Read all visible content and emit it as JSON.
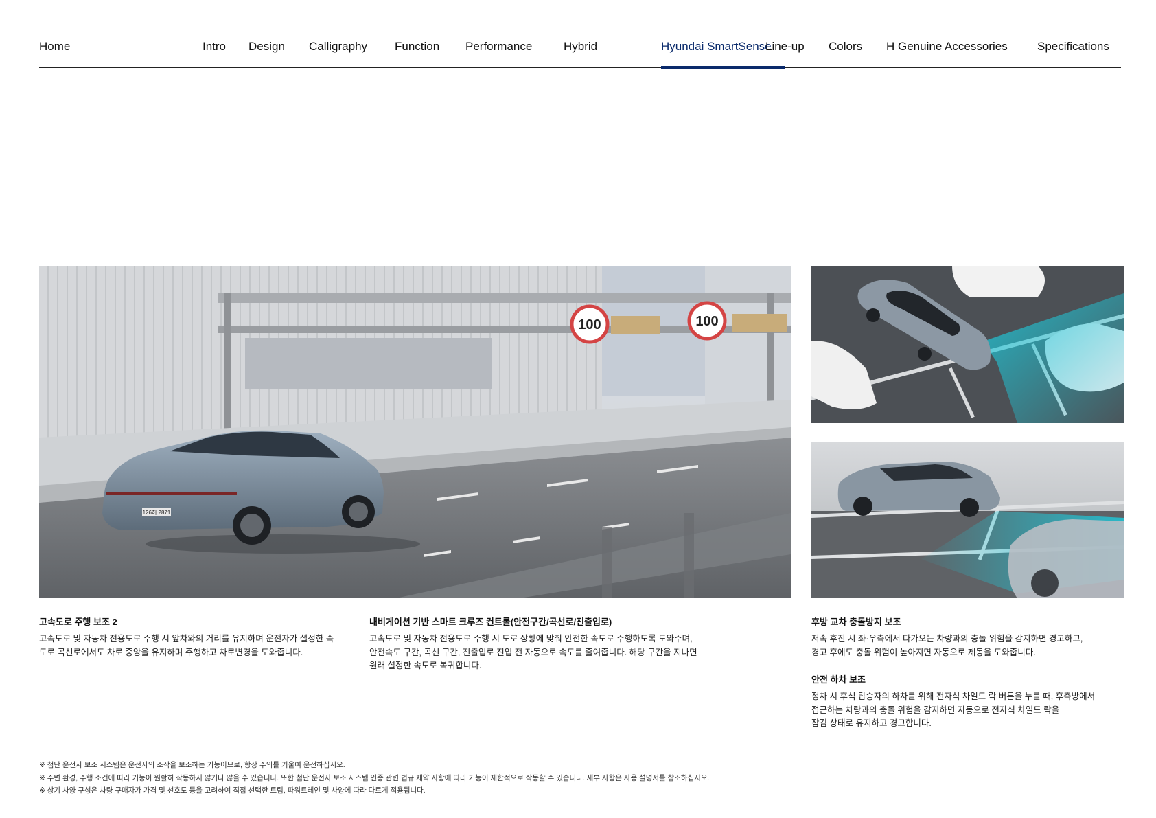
{
  "nav": {
    "items": [
      {
        "label": "Home",
        "active": false
      },
      {
        "label": "Intro",
        "active": false
      },
      {
        "label": "Design",
        "active": false
      },
      {
        "label": "Calligraphy",
        "active": false
      },
      {
        "label": "Function",
        "active": false
      },
      {
        "label": "Performance",
        "active": false
      },
      {
        "label": "Hybrid",
        "active": false
      },
      {
        "label": "Hyundai SmartSense",
        "active": true
      },
      {
        "label": "Line-up",
        "active": false
      },
      {
        "label": "Colors",
        "active": false
      },
      {
        "label": "H Genuine Accessories",
        "active": false
      },
      {
        "label": "Specifications",
        "active": false
      }
    ],
    "active_color": "#0a2a6b"
  },
  "images": {
    "highway": {
      "sign_text": "100",
      "plate_text": "126허 2871"
    }
  },
  "features": [
    {
      "title": "고속도로 주행 보조 2",
      "body": "고속도로 및 자동차 전용도로 주행 시 앞차와의 거리를 유지하며 운전자가 설정한 속\n도로 곡선로에서도 차로 중앙을 유지하며 주행하고 차로변경을 도와줍니다."
    },
    {
      "title": "내비게이션 기반 스마트 크루즈 컨트롤(안전구간/곡선로/진출입로)",
      "body": "고속도로 및 자동차 전용도로 주행 시 도로 상황에 맞춰 안전한 속도로 주행하도록 도와주며,\n안전속도 구간, 곡선 구간, 진출입로 진입 전 자동으로 속도를 줄여줍니다. 해당 구간을 지나면\n원래 설정한 속도로 복귀합니다."
    },
    {
      "title": "후방 교차 충돌방지 보조",
      "body": "저속 후진 시 좌·우측에서 다가오는 차량과의 충돌 위험을 감지하면 경고하고,\n경고 후에도 충돌 위험이 높아지면 자동으로 제동을 도와줍니다."
    },
    {
      "title": "안전 하차 보조",
      "body": "정차 시 후석 탑승자의 하차를 위해 전자식 차일드 락 버튼을 누를 때, 후측방에서\n접근하는 차량과의 충돌 위험을 감지하면 자동으로 전자식 차일드 락을\n잠김 상태로 유지하고 경고합니다."
    }
  ],
  "notes": [
    "※ 첨단 운전자 보조 시스템은 운전자의 조작을 보조하는 기능이므로, 항상 주의를 기울여 운전하십시오.",
    "※ 주변 환경, 주행 조건에 따라 기능이 원활히 작동하지 않거나 않을 수 있습니다. 또한 첨단 운전자 보조 시스템 인증 관련 법규 제약 사항에 따라 기능이 제한적으로 작동할 수 있습니다. 세부 사항은 사용 설명서를 참조하십시오.",
    "※ 상기 사양 구성은 차량 구매자가 가격 및 선호도 등을 고려하여 직접 선택한 트림, 파워트레인 및 사양에 따라 다르게 적용됩니다."
  ],
  "colors": {
    "accent_navy": "#0a2a6b",
    "sensor_cyan": "#1fc7d8"
  }
}
